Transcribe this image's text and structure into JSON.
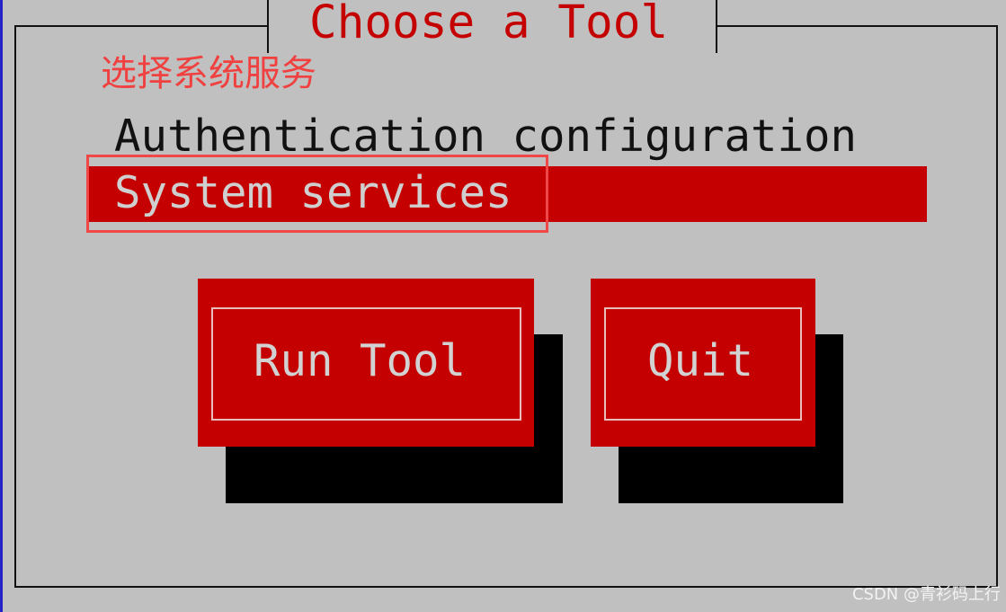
{
  "dialog": {
    "title": "Choose a Tool",
    "annotation_label": "选择系统服务"
  },
  "tool_list": {
    "items": [
      {
        "label": "Authentication configuration",
        "selected": false
      },
      {
        "label": "System services",
        "selected": true
      }
    ]
  },
  "buttons": {
    "run_tool": "Run Tool",
    "quit": "Quit"
  },
  "watermark": "CSDN @青衫码上行",
  "colors": {
    "background": "#c0c0c0",
    "accent_red": "#c40000",
    "annotation_red": "#f04040",
    "shadow": "#000000",
    "left_edge_blue": "#2323c8"
  }
}
